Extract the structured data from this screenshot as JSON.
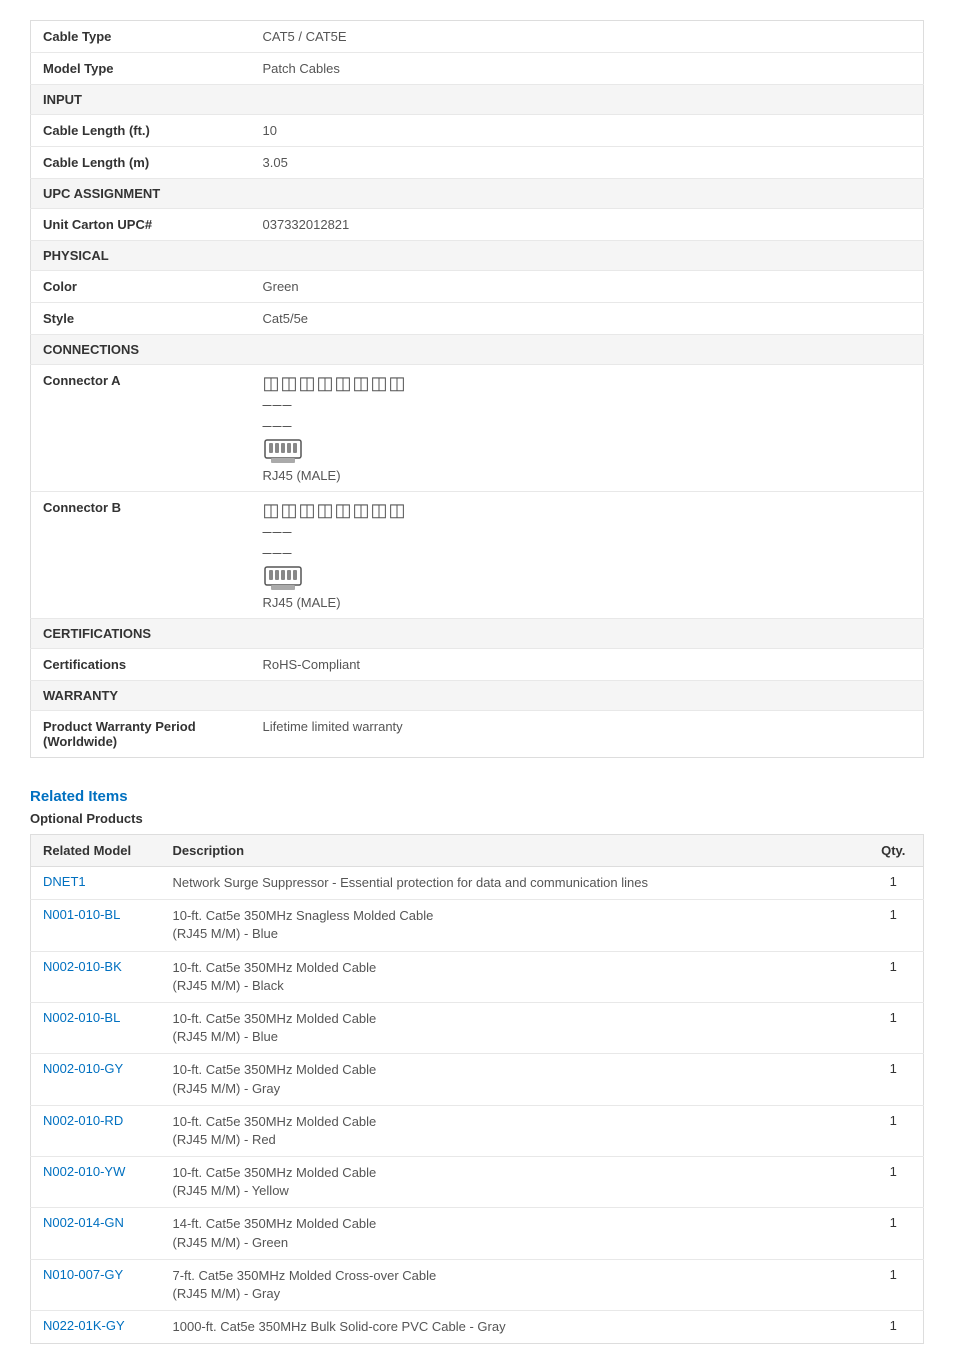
{
  "specs": {
    "rows": [
      {
        "type": "data",
        "label": "Cable Type",
        "value": "CAT5 / CAT5E"
      },
      {
        "type": "data",
        "label": "Model Type",
        "value": "Patch Cables"
      },
      {
        "type": "section",
        "label": "INPUT"
      },
      {
        "type": "data",
        "label": "Cable Length (ft.)",
        "value": "10"
      },
      {
        "type": "data",
        "label": "Cable Length (m)",
        "value": "3.05"
      },
      {
        "type": "section",
        "label": "UPC ASSIGNMENT"
      },
      {
        "type": "data",
        "label": "Unit Carton UPC#",
        "value": "037332012821"
      },
      {
        "type": "section",
        "label": "PHYSICAL"
      },
      {
        "type": "data",
        "label": "Color",
        "value": "Green"
      },
      {
        "type": "data",
        "label": "Style",
        "value": "Cat5/5e"
      },
      {
        "type": "section",
        "label": "CONNECTIONS"
      },
      {
        "type": "connector",
        "label": "Connector A",
        "value": "RJ45 (MALE)"
      },
      {
        "type": "connector",
        "label": "Connector B",
        "value": "RJ45 (MALE)"
      },
      {
        "type": "section",
        "label": "CERTIFICATIONS"
      },
      {
        "type": "data",
        "label": "Certifications",
        "value": "RoHS-Compliant"
      },
      {
        "type": "section",
        "label": "WARRANTY"
      },
      {
        "type": "data",
        "label": "Product Warranty Period (Worldwide)",
        "value": "Lifetime limited warranty"
      }
    ]
  },
  "related_items": {
    "title": "Related Items",
    "optional_label": "Optional Products",
    "columns": {
      "model": "Related Model",
      "description": "Description",
      "qty": "Qty."
    },
    "rows": [
      {
        "model": "DNET1",
        "description": "Network Surge Suppressor - Essential protection for data and communication lines",
        "qty": "1"
      },
      {
        "model": "N001-010-BL",
        "description": "10-ft. Cat5e 350MHz Snagless Molded Cable\n(RJ45 M/M) - Blue",
        "qty": "1"
      },
      {
        "model": "N002-010-BK",
        "description": "10-ft. Cat5e 350MHz Molded Cable\n(RJ45 M/M) - Black",
        "qty": "1"
      },
      {
        "model": "N002-010-BL",
        "description": "10-ft. Cat5e 350MHz Molded Cable\n(RJ45 M/M) - Blue",
        "qty": "1"
      },
      {
        "model": "N002-010-GY",
        "description": "10-ft. Cat5e 350MHz Molded Cable\n(RJ45 M/M) - Gray",
        "qty": "1"
      },
      {
        "model": "N002-010-RD",
        "description": "10-ft. Cat5e 350MHz Molded Cable\n(RJ45 M/M) - Red",
        "qty": "1"
      },
      {
        "model": "N002-010-YW",
        "description": "10-ft. Cat5e 350MHz Molded Cable\n(RJ45 M/M) - Yellow",
        "qty": "1"
      },
      {
        "model": "N002-014-GN",
        "description": "14-ft. Cat5e 350MHz Molded Cable\n(RJ45 M/M) - Green",
        "qty": "1"
      },
      {
        "model": "N010-007-GY",
        "description": "7-ft. Cat5e 350MHz Molded Cross-over Cable\n(RJ45 M/M) - Gray",
        "qty": "1"
      },
      {
        "model": "N022-01K-GY",
        "description": "1000-ft. Cat5e 350MHz Bulk Solid-core PVC Cable - Gray",
        "qty": "1"
      }
    ]
  }
}
